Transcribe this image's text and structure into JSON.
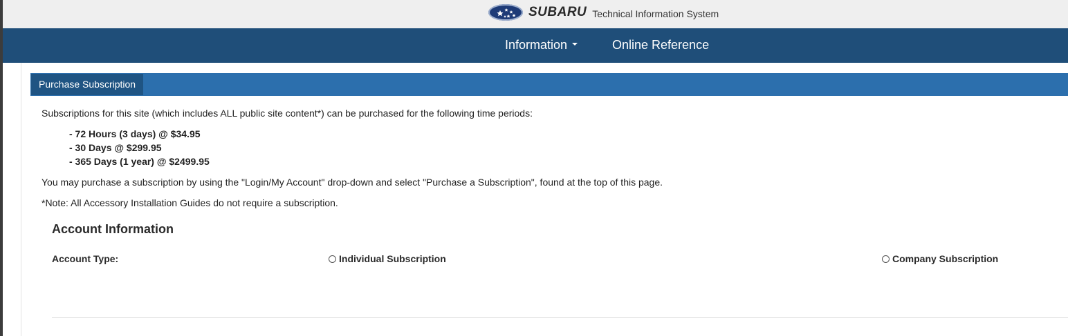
{
  "brand": {
    "logo_icon": "subaru-star-logo-icon",
    "name": "SUBARU",
    "subtitle": "Technical Information System",
    "colors": {
      "logo_blue": "#1e3b77"
    }
  },
  "nav": {
    "items": [
      {
        "label": "Information",
        "has_dropdown": true
      },
      {
        "label": "Online Reference",
        "has_dropdown": false
      }
    ],
    "background": "#1f4e79"
  },
  "panel": {
    "tab_label": "Purchase Subscription",
    "header_color": "#2c6fad"
  },
  "intro": "Subscriptions for this site (which includes ALL public site content*) can be purchased for the following time periods:",
  "prices": [
    "- 72 Hours (3 days) @ $34.95",
    "- 30 Days @ $299.95",
    "- 365 Days (1 year) @ $2499.95"
  ],
  "instructions": "You may purchase a subscription by using the \"Login/My Account\" drop-down and select \"Purchase a Subscription\", found at the top of this page.",
  "note": "*Note: All Accessory Installation Guides do not require a subscription.",
  "account": {
    "title": "Account Information",
    "type_label": "Account Type:",
    "options": [
      {
        "label": "Individual Subscription",
        "selected": false
      },
      {
        "label": "Company Subscription",
        "selected": false
      }
    ]
  }
}
